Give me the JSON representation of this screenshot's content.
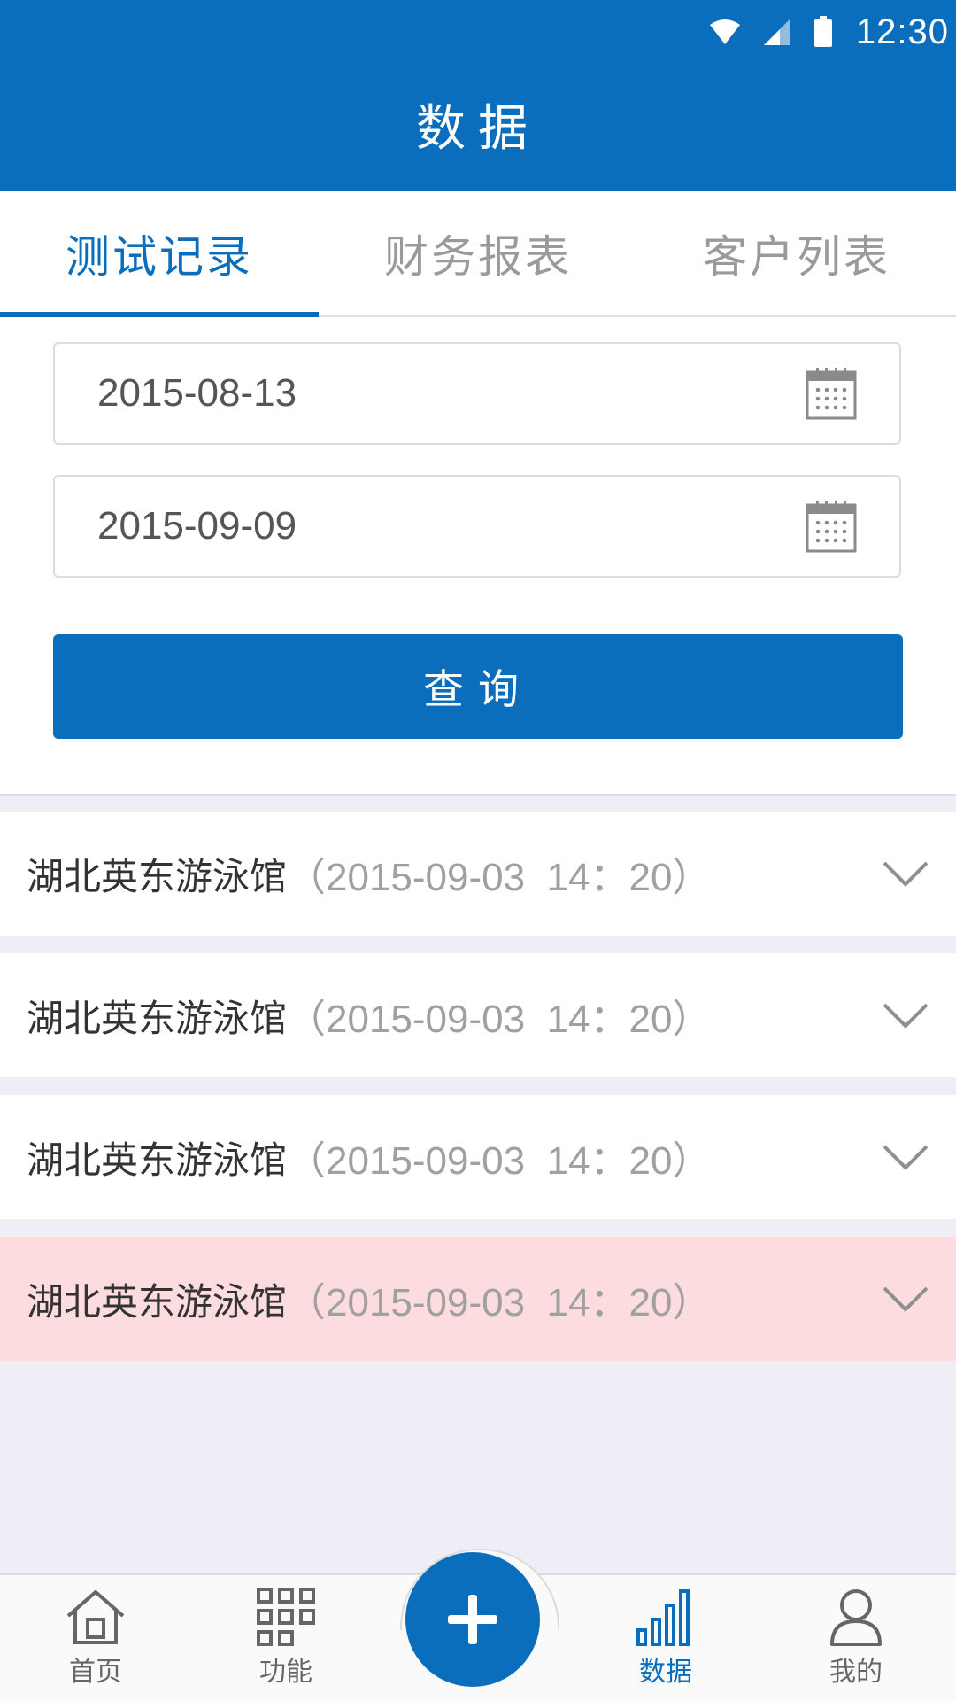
{
  "status_bar": {
    "time": "12:30"
  },
  "header": {
    "title": "数据"
  },
  "tabs": [
    {
      "label": "测试记录",
      "active": true
    },
    {
      "label": "财务报表",
      "active": false
    },
    {
      "label": "客户列表",
      "active": false
    }
  ],
  "form": {
    "start_date": "2015-08-13",
    "end_date": "2015-09-09",
    "query_label": "查询"
  },
  "records": [
    {
      "name": "湖北英东游泳馆",
      "time": "（2015-09-03  14：20）",
      "alert": false
    },
    {
      "name": "湖北英东游泳馆",
      "time": "（2015-09-03  14：20）",
      "alert": false
    },
    {
      "name": "湖北英东游泳馆",
      "time": "（2015-09-03  14：20）",
      "alert": false
    },
    {
      "name": "湖北英东游泳馆",
      "time": "（2015-09-03  14：20）",
      "alert": true
    }
  ],
  "bottom_nav": [
    {
      "label": "首页",
      "icon": "home-icon",
      "active": false
    },
    {
      "label": "功能",
      "icon": "grid-icon",
      "active": false
    },
    {
      "label": "",
      "icon": "plus-icon",
      "active": false
    },
    {
      "label": "数据",
      "icon": "signal-bars-icon",
      "active": true
    },
    {
      "label": "我的",
      "icon": "user-icon",
      "active": false
    }
  ],
  "colors": {
    "primary": "#0a6ebd",
    "alert_row": "#fddcdf",
    "background": "#efeef6"
  }
}
